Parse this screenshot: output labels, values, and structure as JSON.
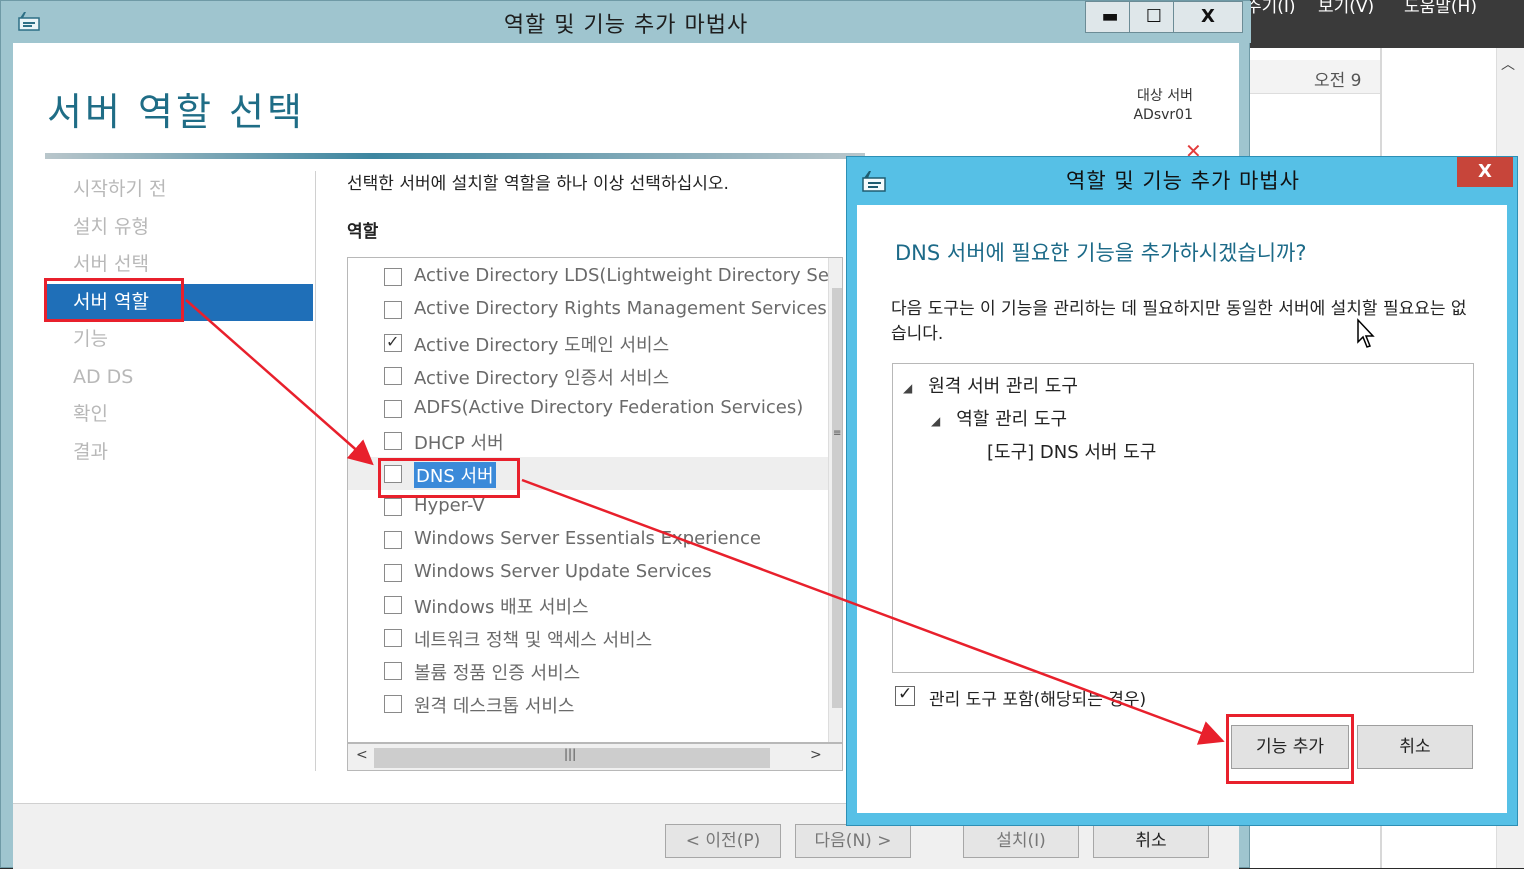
{
  "background_app": {
    "menu_fragments": [
      "주기(I)",
      "보기(V)",
      "도움말(H)"
    ],
    "time_label": "오전 9"
  },
  "main_window": {
    "title": "역할 및 기능 추가 마법사",
    "controls": {
      "minimize": "▬",
      "maximize": "☐",
      "close": "X"
    },
    "page_title": "서버 역할 선택",
    "destination": {
      "label": "대상 서버",
      "server": "ADsvr01"
    },
    "nav": [
      {
        "label": "시작하기 전",
        "active": false
      },
      {
        "label": "설치 유형",
        "active": false
      },
      {
        "label": "서버 선택",
        "active": false
      },
      {
        "label": "서버 역할",
        "active": true
      },
      {
        "label": "기능",
        "active": false
      },
      {
        "label": "AD DS",
        "active": false
      },
      {
        "label": "확인",
        "active": false
      },
      {
        "label": "결과",
        "active": false
      }
    ],
    "instruction": "선택한 서버에 설치할 역할을 하나 이상 선택하십시오.",
    "roles_heading": "역할",
    "roles": [
      {
        "label": "Active Directory LDS(Lightweight Directory Servi",
        "checked": false
      },
      {
        "label": "Active Directory Rights Management Services",
        "checked": false
      },
      {
        "label": "Active Directory 도메인 서비스",
        "checked": true
      },
      {
        "label": "Active Directory 인증서 서비스",
        "checked": false
      },
      {
        "label": "ADFS(Active Directory Federation Services)",
        "checked": false
      },
      {
        "label": "DHCP 서버",
        "checked": false
      },
      {
        "label": "DNS 서버",
        "checked": false,
        "selected": true
      },
      {
        "label": "Hyper-V",
        "checked": false
      },
      {
        "label": "Windows Server Essentials Experience",
        "checked": false
      },
      {
        "label": "Windows Server Update Services",
        "checked": false
      },
      {
        "label": "Windows 배포 서비스",
        "checked": false
      },
      {
        "label": "네트워크 정책 및 액세스 서비스",
        "checked": false
      },
      {
        "label": "볼륨 정품 인증 서비스",
        "checked": false
      },
      {
        "label": "원격 데스크톱 서비스",
        "checked": false
      }
    ],
    "buttons": {
      "prev": "< 이전(P)",
      "next": "다음(N) >",
      "install": "설치(I)",
      "cancel": "취소"
    }
  },
  "dialog": {
    "title": "역할 및 기능 추가 마법사",
    "close": "X",
    "question": "DNS 서버에 필요한 기능을 추가하시겠습니까?",
    "description": "다음 도구는 이 기능을 관리하는 데 필요하지만 동일한 서버에 설치할 필요요는 없습니다.",
    "tree": [
      {
        "label": "원격 서버 관리 도구"
      },
      {
        "label": "역할 관리 도구"
      },
      {
        "label": "[도구] DNS 서버 도구"
      }
    ],
    "include_tools_label": "관리 도구 포함(해당되는 경우)",
    "include_tools_checked": true,
    "buttons": {
      "add": "기능 추가",
      "cancel": "취소"
    }
  },
  "colors": {
    "title_accent": "#1f6d86",
    "nav_active": "#1f6fb8",
    "dialog_frame": "#56c0e6",
    "annotation": "#e8202c"
  }
}
